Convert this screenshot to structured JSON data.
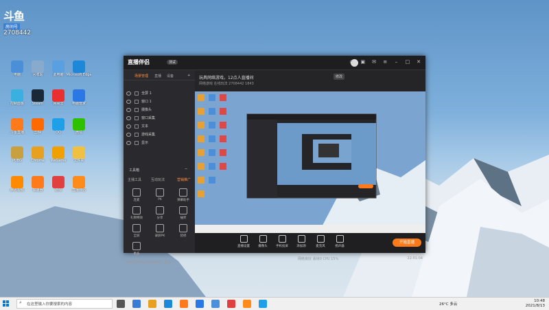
{
  "overlay": {
    "logo": "斗鱼",
    "label": "房间号",
    "room_number": "2708442"
  },
  "desktop_icons": [
    {
      "label": "电脑",
      "color": "#4a8fd8"
    },
    {
      "label": "回收站",
      "color": "#88aacc"
    },
    {
      "label": "此电脑",
      "color": "#5aa0e0"
    },
    {
      "label": "Microsoft Edge",
      "color": "#1e88d8"
    },
    {
      "label": "控制面板",
      "color": "#3ab0e0"
    },
    {
      "label": "Steam",
      "color": "#1b2838"
    },
    {
      "label": "网易云",
      "color": "#e83030"
    },
    {
      "label": "电脑管家",
      "color": "#2b78e4"
    },
    {
      "label": "斗鱼直播",
      "color": "#ff7a1a"
    },
    {
      "label": "剪映",
      "color": "#ff6a00"
    },
    {
      "label": "QQ",
      "color": "#1ea0e8"
    },
    {
      "label": "微信",
      "color": "#2dc100"
    },
    {
      "label": "PUBG",
      "color": "#c8a040"
    },
    {
      "label": "Chrome",
      "color": "#e8a020"
    },
    {
      "label": "WeGame",
      "color": "#f0a000"
    },
    {
      "label": "文件夹",
      "color": "#f0c040"
    },
    {
      "label": "腾讯视频",
      "color": "#ff8a00"
    },
    {
      "label": "加速器",
      "color": "#ff7a1a"
    },
    {
      "label": "游戏",
      "color": "#e04040"
    },
    {
      "label": "直播伴侣",
      "color": "#ff8c1a"
    }
  ],
  "window": {
    "brand": "直播伴侣",
    "brand_badge": "测试",
    "stream_title": "玩具网络游戏，12点人直播间",
    "edit_label": "修改",
    "stream_meta": "网络游戏   在线玩法   2708442   1843",
    "tabs": [
      "场景管理",
      "直播",
      "设备"
    ],
    "sources": [
      "全屏 1",
      "窗口 1",
      "摄像头",
      "窗口采集",
      "文本",
      "游戏采集",
      "显示"
    ],
    "toolbox_title": "工具箱",
    "tool_tabs": [
      "主播工具",
      "互动玩法",
      "营销推广"
    ],
    "tools": [
      "连麦",
      "PK",
      "弹幕助手",
      "礼物特效",
      "分享",
      "抽奖",
      "全屏",
      "录屏PK",
      "装修",
      "更多"
    ],
    "bottom_tools": [
      "直播设置",
      "摄像头",
      "手机投屏",
      "添加源",
      "麦克风",
      "扬声器"
    ],
    "live_button": "开始直播",
    "notice": "如何把手机游戏画面接入直播",
    "status_left": "网络良好  丢帧0  CPU 15%",
    "status_right": "22:01:04"
  },
  "taskbar": {
    "search_placeholder": "在这里输入你要搜索的内容",
    "weather": "26°C 多云",
    "time": "10:48",
    "date": "2021/8/13"
  },
  "colors": {
    "accent": "#ff7a1a",
    "taskbar": "#f0f0f0",
    "window_bg": "#252528"
  }
}
